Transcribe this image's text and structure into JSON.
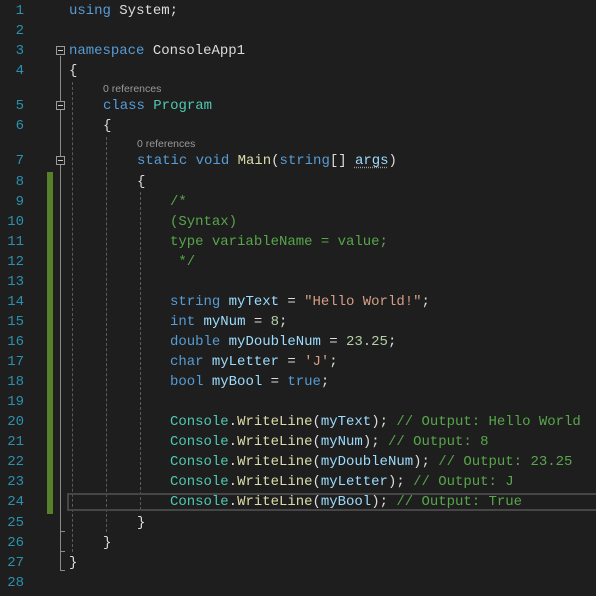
{
  "editor": {
    "language": "C#",
    "theme_colors": {
      "background": "#1e1e1e",
      "line_number": "#2b91af",
      "keyword": "#569cd6",
      "type": "#4ec9b0",
      "method": "#dcdcaa",
      "variable": "#9cdcfe",
      "string": "#d69d85",
      "number": "#b5cea8",
      "comment": "#57a64a",
      "change_marker": "#57802b"
    },
    "codelens": {
      "class_program": "0 references",
      "method_main": "0 references"
    },
    "current_line": 24,
    "changed_lines": [
      8,
      24
    ],
    "line_numbers": [
      "1",
      "2",
      "3",
      "4",
      "5",
      "6",
      "7",
      "8",
      "9",
      "10",
      "11",
      "12",
      "13",
      "14",
      "15",
      "16",
      "17",
      "18",
      "19",
      "20",
      "21",
      "22",
      "23",
      "24",
      "25",
      "26",
      "27",
      "28"
    ],
    "tokens": {
      "l1": {
        "kw": "using",
        "ns": " System;"
      },
      "l3": {
        "kw": "namespace",
        "ns": " ConsoleApp1"
      },
      "l4": {
        "brace": "{"
      },
      "l5": {
        "kw": "class",
        "type": " Program"
      },
      "l6": {
        "brace": "{"
      },
      "l7": {
        "kw1": "static",
        "kw2": " void",
        "method": " Main",
        "p1": "(",
        "kw3": "string",
        "p2": "[] ",
        "param": "args",
        "p3": ")"
      },
      "l8": {
        "brace": "{"
      },
      "l9": {
        "cm": "/*"
      },
      "l10": {
        "cm": "(Syntax)"
      },
      "l11": {
        "cm": "type variableName = value;"
      },
      "l12": {
        "cm": " */"
      },
      "l14": {
        "kw": "string",
        "var": " myText",
        "op": " = ",
        "str": "\"Hello World!\"",
        "end": ";"
      },
      "l15": {
        "kw": "int",
        "var": " myNum",
        "op": " = ",
        "num": "8",
        "end": ";"
      },
      "l16": {
        "kw": "double",
        "var": " myDoubleNum",
        "op": " = ",
        "num": "23.25",
        "end": ";"
      },
      "l17": {
        "kw": "char",
        "var": " myLetter",
        "op": " = ",
        "str": "'J'",
        "end": ";"
      },
      "l18": {
        "kw": "bool",
        "var": " myBool",
        "op": " = ",
        "kw2": "true",
        "end": ";"
      },
      "l20": {
        "type": "Console",
        "dot": ".",
        "method": "WriteLine",
        "open": "(",
        "var": "myText",
        "close": "); ",
        "cm": "// Output: Hello World"
      },
      "l21": {
        "type": "Console",
        "dot": ".",
        "method": "WriteLine",
        "open": "(",
        "var": "myNum",
        "close": "); ",
        "cm": "// Output: 8"
      },
      "l22": {
        "type": "Console",
        "dot": ".",
        "method": "WriteLine",
        "open": "(",
        "var": "myDoubleNum",
        "close": "); ",
        "cm": "// Output: 23.25"
      },
      "l23": {
        "type": "Console",
        "dot": ".",
        "method": "WriteLine",
        "open": "(",
        "var": "myLetter",
        "close": "); ",
        "cm": "// Output: J"
      },
      "l24": {
        "type": "Console",
        "dot": ".",
        "method": "WriteLine",
        "open": "(",
        "var": "myBool",
        "close": "); ",
        "cm": "// Output: True"
      },
      "l25": {
        "brace": "}"
      },
      "l26": {
        "brace": "}"
      },
      "l27": {
        "brace": "}"
      }
    }
  }
}
